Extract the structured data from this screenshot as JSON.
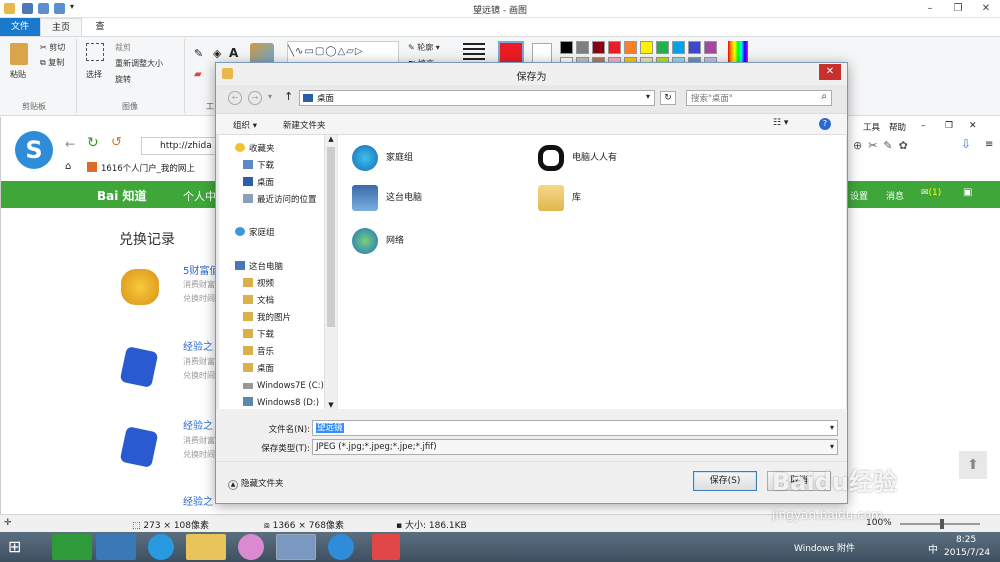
{
  "paint": {
    "title": "望远镜 - 画图",
    "tabs": [
      "文件",
      "主页",
      "查看"
    ],
    "clipboard": {
      "paste": "粘贴",
      "cut": "剪切",
      "copy": "复制",
      "group": "剪贴板"
    },
    "image": {
      "select": "选择",
      "crop": "裁剪",
      "resize": "重新调整大小",
      "rotate": "旋转",
      "group": "图像"
    },
    "tools_group": "工",
    "shapes": {
      "outline": "轮廓",
      "fill": "填充"
    },
    "palette": [
      "#000000",
      "#7f7f7f",
      "#880015",
      "#ed1c24",
      "#ff7f27",
      "#fff200",
      "#22b14c",
      "#00a2e8",
      "#3f48cc",
      "#a349a4"
    ],
    "palette2": [
      "#ffffff",
      "#c3c3c3",
      "#b97a57",
      "#ffaec9",
      "#ffc90e",
      "#efe4b0",
      "#b5e61d",
      "#99d9ea",
      "#7092be",
      "#c8bfe7"
    ],
    "color1": "#ed1c24",
    "color2": "#ffffff"
  },
  "browser": {
    "url": "http://zhida",
    "tab": "1616个人门户_我的网上",
    "menu": [
      "工具",
      "帮助"
    ],
    "baidu_logo": "Bai 知道",
    "nav_item": "个人中",
    "right_nav": [
      "设置",
      "消息",
      "(1)"
    ],
    "section_title": "兑换记录",
    "records": [
      {
        "title": "5财富值",
        "line1": "消费财富",
        "line2": "兑换时间"
      },
      {
        "title": "经验之",
        "line1": "消费财富",
        "line2": "兑换时间"
      },
      {
        "title": "经验之",
        "line1": "消费财富",
        "line2": "兑换时间"
      },
      {
        "title": "经验之",
        "line1": "",
        "line2": ""
      }
    ]
  },
  "dialog": {
    "title": "保存为",
    "address": "桌面",
    "search_placeholder": "搜索\"桌面\"",
    "organize": "组织",
    "new_folder": "新建文件夹",
    "nav": {
      "favorites": "收藏夹",
      "fav_items": [
        "下载",
        "桌面",
        "最近访问的位置"
      ],
      "homegroup": "家庭组",
      "thispc": "这台电脑",
      "pc_items": [
        "视频",
        "文档",
        "我的图片",
        "下载",
        "音乐",
        "桌面",
        "Windows7E (C:)",
        "Windows8 (D:)"
      ]
    },
    "files": [
      {
        "name": "家庭组",
        "icon": "homegroup-icon"
      },
      {
        "name": "电脑人人有",
        "icon": "panda-icon"
      },
      {
        "name": "这台电脑",
        "icon": "computer-icon"
      },
      {
        "name": "库",
        "icon": "library-icon"
      },
      {
        "name": "网络",
        "icon": "network-icon"
      }
    ],
    "filename_label": "文件名(N):",
    "filename_value": "望远镜",
    "filetype_label": "保存类型(T):",
    "filetype_value": "JPEG (*.jpg;*.jpeg;*.jpe;*.jfif)",
    "hide_folders": "隐藏文件夹",
    "save": "保存(S)",
    "cancel": "取消"
  },
  "status": {
    "dimensions": "273 × 108像素",
    "canvas": "1366 × 768像素",
    "size": "大小: 186.1KB",
    "zoom": "100%"
  },
  "taskbar": {
    "lang": "Windows 附件",
    "ime": "中",
    "time": "8:25",
    "date": "2015/7/24"
  },
  "watermark": {
    "text": "Baidu经验",
    "url": "jingyan.baidu.com"
  }
}
